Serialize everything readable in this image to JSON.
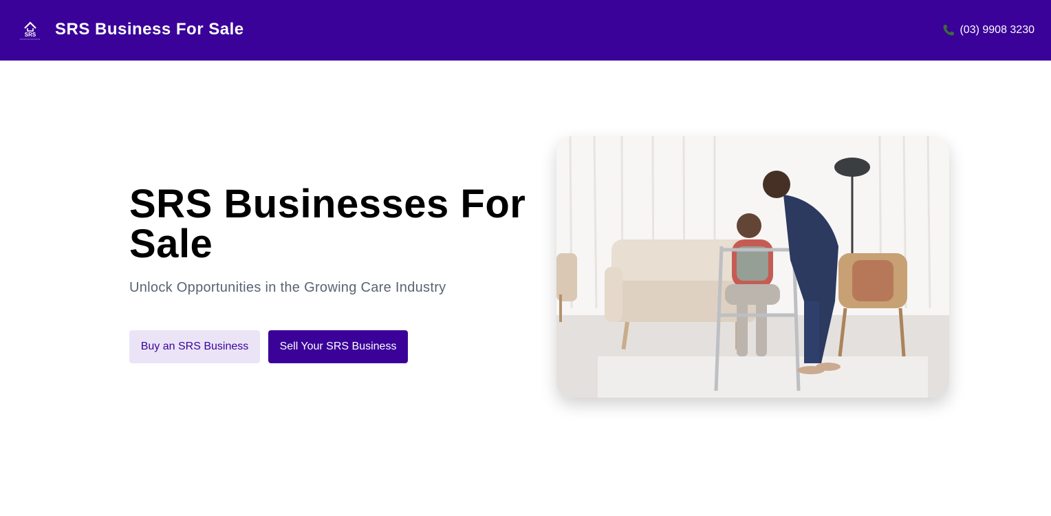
{
  "header": {
    "brand": "SRS Business For Sale",
    "logo_text": "SRS",
    "logo_icon": "house-roof-icon",
    "phone": "(03) 9908 3230",
    "phone_icon": "phone-icon",
    "background_color": "#3a0299"
  },
  "hero": {
    "title": "SRS Businesses For Sale",
    "subtitle": "Unlock Opportunities in the Growing Care Industry",
    "buttons": {
      "buy_label": "Buy an SRS Business",
      "sell_label": "Sell Your SRS Business"
    },
    "image_alt": "carer helping senior woman with walking frame"
  },
  "colors": {
    "primary": "#3a0299",
    "secondary_button": "#ebe4f7",
    "subtitle_text": "#5a6273"
  }
}
